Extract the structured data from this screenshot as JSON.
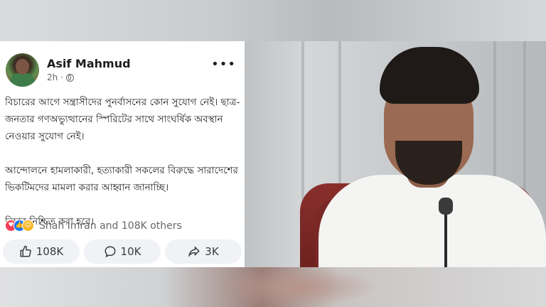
{
  "post": {
    "author": "Asif Mahmud",
    "time": "2h",
    "separator": "·",
    "more": "•••",
    "text": "বিচারের আগে সন্ত্রাসীদের পুনর্বাসনের কোন সুযোগ নেই। ছাত্র-জনতার গণঅভ্যুত্থানের স্পিরিটের সাথে সাংঘর্ষিক অবস্থান নেওয়ার সুযোগ নেই।\n\nআন্দোলনে হামলাকারী, হত্যাকারী সকলের বিরুদ্ধে সারাদেশের ভিকটিমদের মামলা করার আহ্বান জানাচ্ছি।\n\nবিচার নিশ্চিত করা হবে।",
    "reactions": "Shah Imran and 108K others",
    "actions": {
      "like": "108K",
      "comment": "10K",
      "share": "3K"
    }
  },
  "colors": {
    "fb_blue": "#1877f2",
    "love": "#f33e58",
    "haha": "#f7b928",
    "chair": "#8a2f2b"
  }
}
